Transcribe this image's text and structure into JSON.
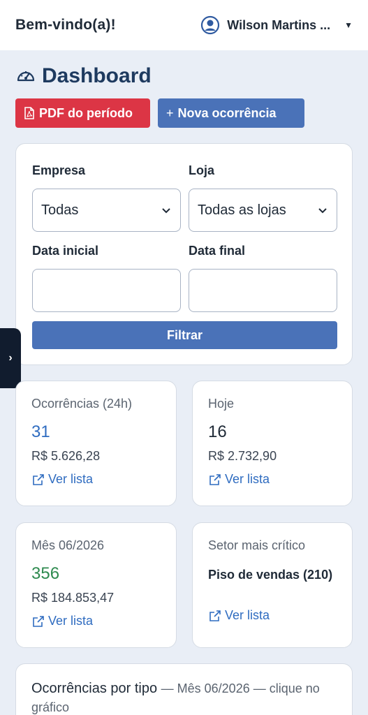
{
  "header": {
    "welcome": "Bem-vindo(a)!",
    "user_name": "Wilson Martins ...",
    "user_avatar_icon": "user-circle-icon",
    "caret_icon": "caret-down-icon"
  },
  "page": {
    "title": "Dashboard",
    "title_icon": "gauge-icon"
  },
  "actions": {
    "pdf_label": "PDF do período",
    "pdf_icon": "file-pdf-icon",
    "new_label": "Nova ocorrência",
    "new_icon": "plus-icon"
  },
  "filters": {
    "empresa_label": "Empresa",
    "empresa_value": "Todas",
    "loja_label": "Loja",
    "loja_value": "Todas as lojas",
    "data_inicial_label": "Data inicial",
    "data_inicial_value": "",
    "data_final_label": "Data final",
    "data_final_value": "",
    "filter_button": "Filtrar"
  },
  "sidebar_toggle": {
    "icon": "chevron-right-icon",
    "glyph": "›"
  },
  "stats": {
    "last24h": {
      "label": "Ocorrências (24h)",
      "count": "31",
      "amount": "R$ 5.626,28",
      "link": "Ver lista"
    },
    "today": {
      "label": "Hoje",
      "count": "16",
      "amount": "R$ 2.732,90",
      "link": "Ver lista"
    },
    "month": {
      "label": "Mês 06/2026",
      "count": "356",
      "amount": "R$ 184.853,47",
      "link": "Ver lista"
    },
    "critical": {
      "label": "Setor mais crítico",
      "value": "Piso de vendas (210)",
      "link": "Ver lista"
    }
  },
  "chart_section": {
    "title": "Ocorrências por tipo",
    "subtitle": "— Mês 06/2026 — clique no gráfico"
  },
  "colors": {
    "primary": "#4a72b8",
    "danger": "#dc3545",
    "count_blue": "#2f6cc0",
    "count_green": "#2e8a4f",
    "background": "#e9eef6",
    "sidebar_toggle": "#111c2e"
  }
}
